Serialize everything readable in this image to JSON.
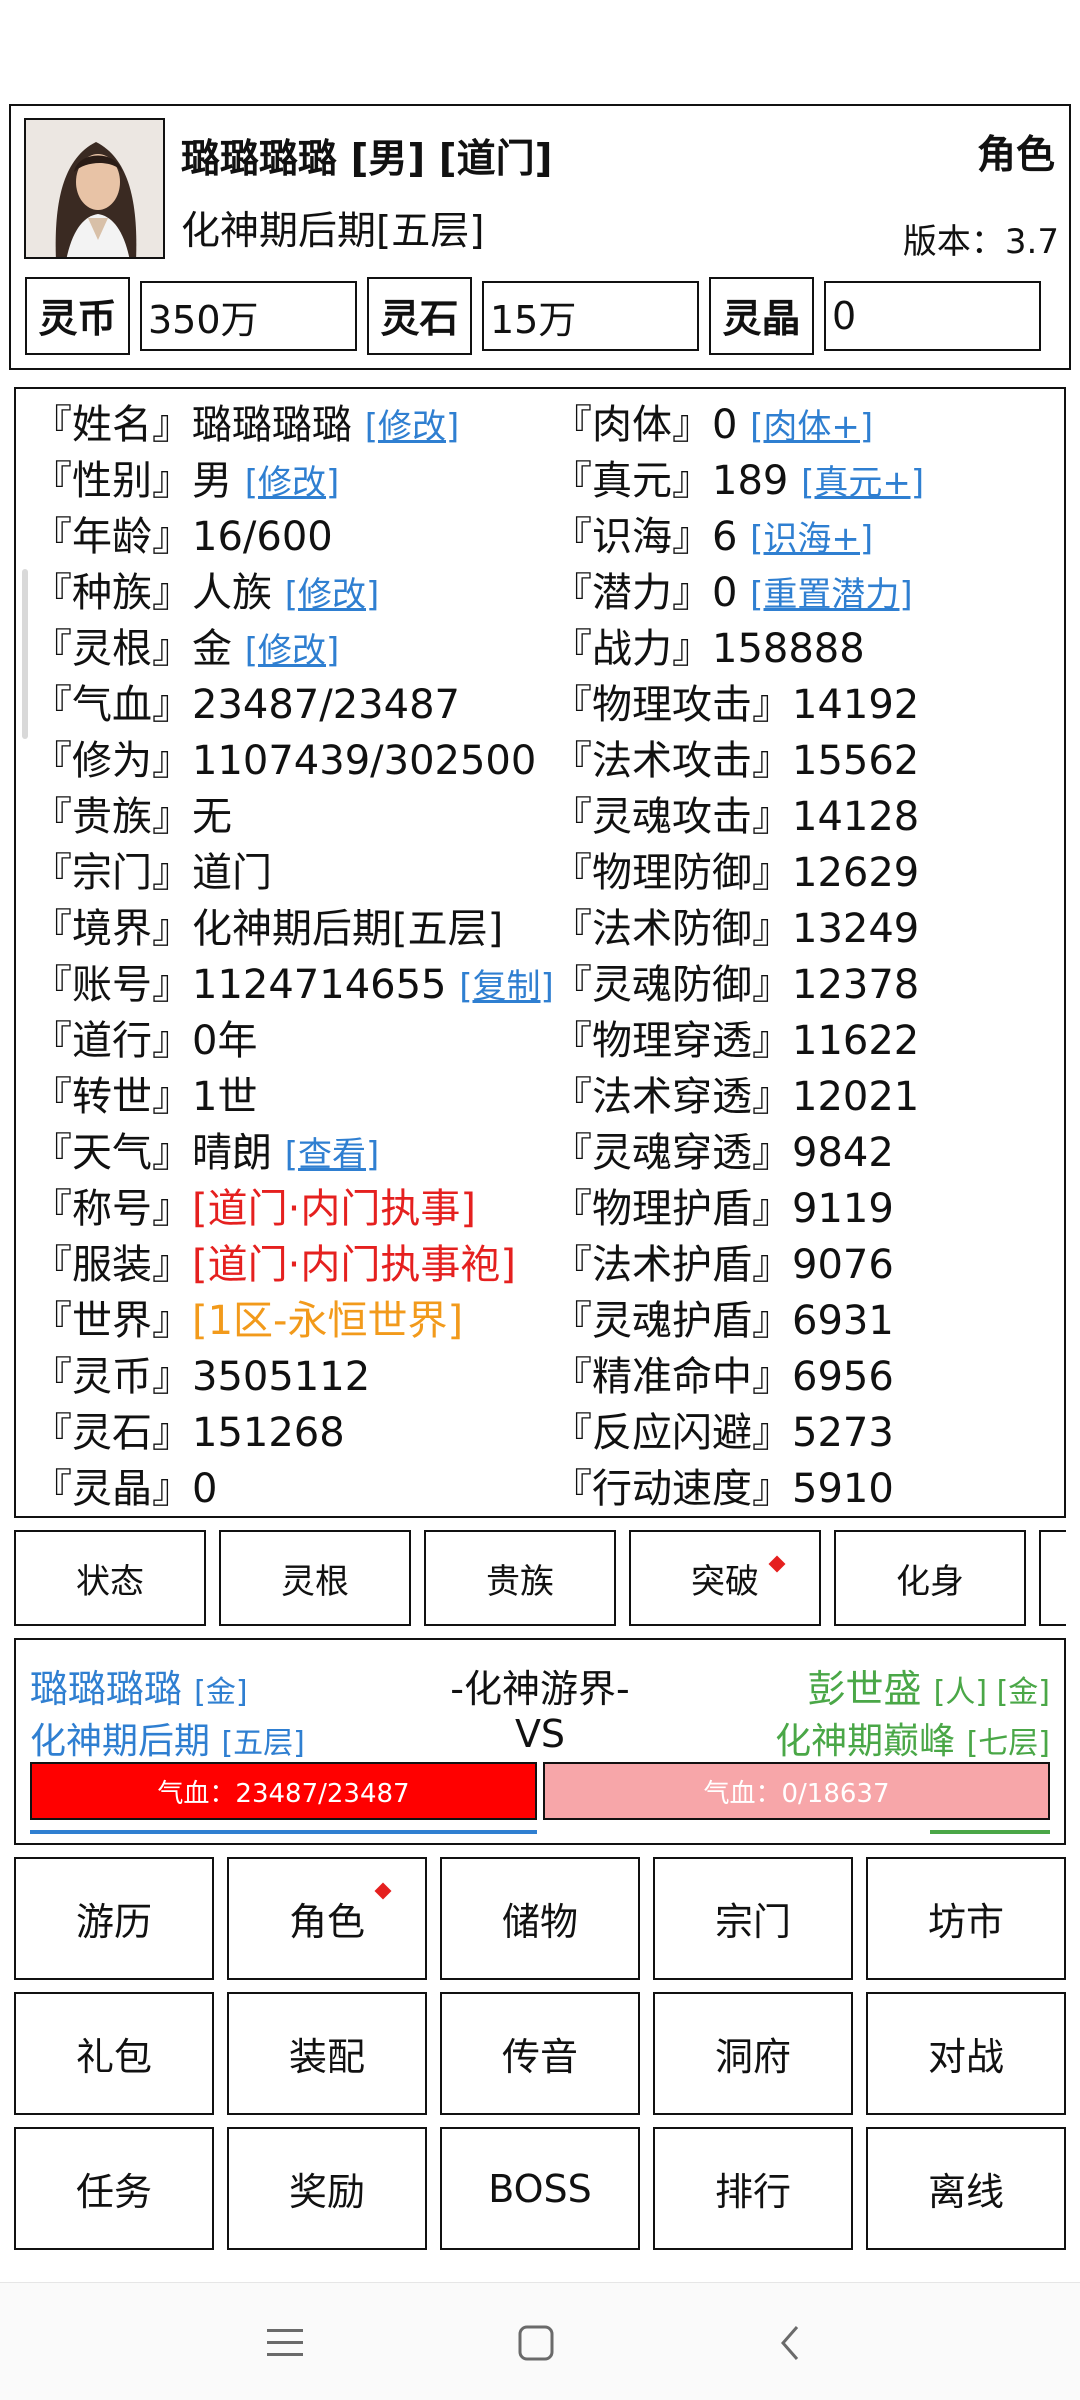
{
  "header": {
    "name_line": "璐璐璐璐 [男] [道门]",
    "realm": "化神期后期[五层]",
    "role_title": "角色",
    "version": "版本：3.7",
    "currencies": [
      {
        "label": "灵币",
        "value": "350万"
      },
      {
        "label": "灵石",
        "value": "15万"
      },
      {
        "label": "灵晶",
        "value": "0"
      }
    ]
  },
  "info": {
    "left": [
      {
        "label": "『姓名』",
        "value": "璐璐璐璐",
        "link": "[修改]"
      },
      {
        "label": "『性别』",
        "value": "男",
        "link": "[修改]"
      },
      {
        "label": "『年龄』",
        "value": "16/600"
      },
      {
        "label": "『种族』",
        "value": "人族",
        "link": "[修改]"
      },
      {
        "label": "『灵根』",
        "value": "金",
        "link": "[修改]"
      },
      {
        "label": "『气血』",
        "value": "23487/23487"
      },
      {
        "label": "『修为』",
        "value": "1107439/302500"
      },
      {
        "label": "『贵族』",
        "value": "无"
      },
      {
        "label": "『宗门』",
        "value": "道门"
      },
      {
        "label": "『境界』",
        "value": "化神期后期[五层]"
      },
      {
        "label": "『账号』",
        "value": "1124714655",
        "link": "[复制]"
      },
      {
        "label": "『道行』",
        "value": "0年"
      },
      {
        "label": "『转世』",
        "value": "1世"
      },
      {
        "label": "『天气』",
        "value": "晴朗",
        "link": "[查看]"
      },
      {
        "label": "『称号』",
        "value": "[道门·内门执事]"
      },
      {
        "label": "『服装』",
        "value": "[道门·内门执事袍]"
      },
      {
        "label": "『世界』",
        "value": "[1区-永恒世界]"
      },
      {
        "label": "『灵币』",
        "value": "3505112"
      },
      {
        "label": "『灵石』",
        "value": "151268"
      },
      {
        "label": "『灵晶』",
        "value": "0"
      }
    ],
    "right": [
      {
        "label": "『肉体』",
        "value": "0",
        "link": "[肉体+]"
      },
      {
        "label": "『真元』",
        "value": "189",
        "link": "[真元+]"
      },
      {
        "label": "『识海』",
        "value": "6",
        "link": "[识海+]"
      },
      {
        "label": "『潜力』",
        "value": "0",
        "link": "[重置潜力]"
      },
      {
        "label": "『战力』",
        "value": "158888"
      },
      {
        "label": "『物理攻击』",
        "value": "14192"
      },
      {
        "label": "『法术攻击』",
        "value": "15562"
      },
      {
        "label": "『灵魂攻击』",
        "value": "14128"
      },
      {
        "label": "『物理防御』",
        "value": "12629"
      },
      {
        "label": "『法术防御』",
        "value": "13249"
      },
      {
        "label": "『灵魂防御』",
        "value": "12378"
      },
      {
        "label": "『物理穿透』",
        "value": "11622"
      },
      {
        "label": "『法术穿透』",
        "value": "12021"
      },
      {
        "label": "『灵魂穿透』",
        "value": "9842"
      },
      {
        "label": "『物理护盾』",
        "value": "9119"
      },
      {
        "label": "『法术护盾』",
        "value": "9076"
      },
      {
        "label": "『灵魂护盾』",
        "value": "6931"
      },
      {
        "label": "『精准命中』",
        "value": "6956"
      },
      {
        "label": "『反应闪避』",
        "value": "5273"
      },
      {
        "label": "『行动速度』",
        "value": "5910"
      }
    ]
  },
  "tabs": [
    "状态",
    "灵根",
    "贵族",
    "突破",
    "化身"
  ],
  "battle": {
    "left_name": "璐璐璐璐",
    "left_tag": "[金]",
    "left_realm": "化神期后期",
    "left_layer": "[五层]",
    "map_title": "-化神游界-",
    "vs": "VS",
    "right_name": "彭世盛",
    "right_tag": "[人] [金]",
    "right_realm": "化神期巅峰",
    "right_layer": "[七层]",
    "left_hp": "气血：23487/23487",
    "right_hp": "气血：0/18637",
    "left_hp_fraction": 1.0,
    "right_hp_fraction": 0.0
  },
  "menu": [
    [
      "游历",
      "角色",
      "储物",
      "宗门",
      "坊市"
    ],
    [
      "礼包",
      "装配",
      "传音",
      "洞府",
      "对战"
    ],
    [
      "任务",
      "奖励",
      "BOSS",
      "排行",
      "离线"
    ]
  ],
  "colors": {
    "link": "#2f7fd1",
    "title_red": "#e5201f",
    "world_orange": "#f29a1b",
    "enemy_green": "#4aa747",
    "hp_red": "#ff0000",
    "hp_empty": "#f7a6a9"
  },
  "icons": {
    "nav_menu": "menu-lines-icon",
    "nav_home": "home-square-icon",
    "nav_back": "back-chevron-icon",
    "notify": "red-diamond-dot-icon"
  }
}
